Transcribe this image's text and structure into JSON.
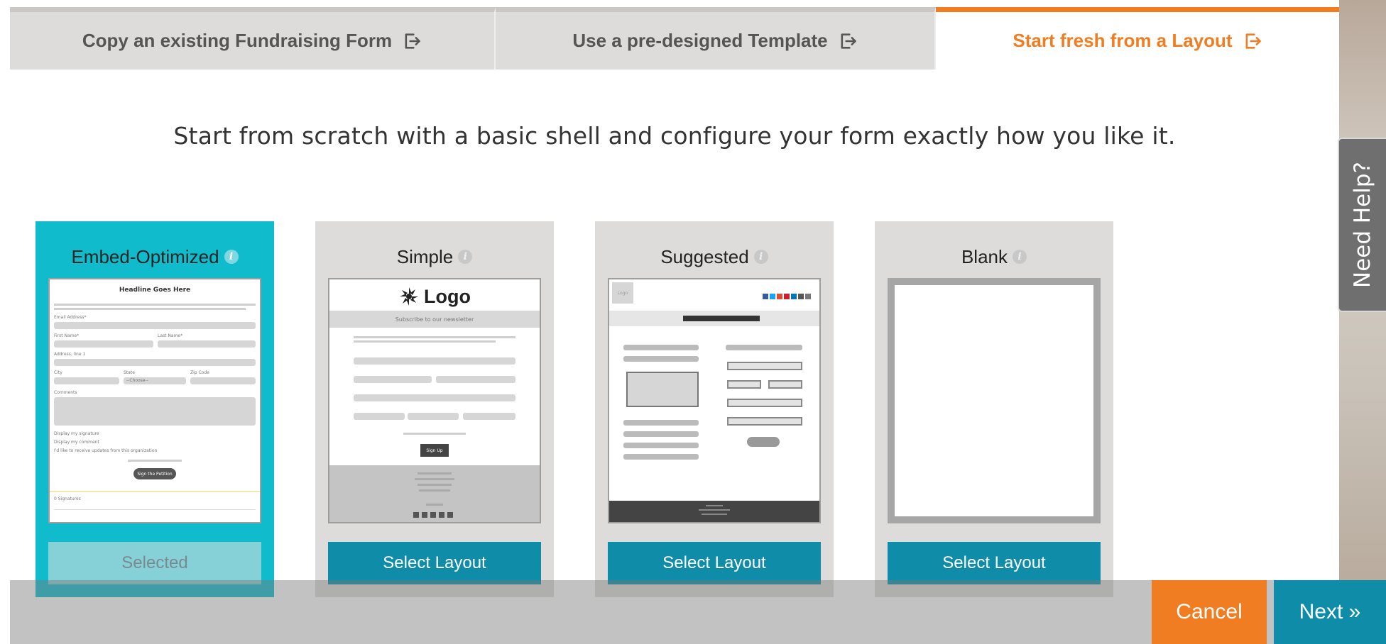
{
  "tabs": [
    {
      "label": "Copy an existing Fundraising Form",
      "active": false
    },
    {
      "label": "Use a pre-designed Template",
      "active": false
    },
    {
      "label": "Start fresh from a Layout",
      "active": true
    }
  ],
  "intro": "Start from scratch with a basic shell and configure your form exactly how you like it.",
  "cards": [
    {
      "title": "Embed-Optimized",
      "button": "Selected",
      "selected": true
    },
    {
      "title": "Simple",
      "button": "Select Layout",
      "selected": false
    },
    {
      "title": "Suggested",
      "button": "Select Layout",
      "selected": false
    },
    {
      "title": "Blank",
      "button": "Select Layout",
      "selected": false
    }
  ],
  "thumbs": {
    "embed": {
      "headline": "Headline Goes Here",
      "email": "Email Address*",
      "first": "First Name*",
      "last": "Last Name*",
      "address": "Address, line 1",
      "city": "City",
      "state": "State",
      "zip": "Zip Code",
      "state_value": "--Choose--",
      "comments": "Comments",
      "check1": "Display my signature",
      "check2": "Display my comment",
      "check3": "I'd like to receive updates from this organization",
      "submit": "Sign the Petition",
      "signatures": "0 Signatures"
    },
    "simple": {
      "logo": "Logo",
      "subtitle": "Subscribe to our newsletter",
      "submit": "Sign Up"
    },
    "suggested": {
      "logo": "Logo"
    }
  },
  "footer": {
    "cancel": "Cancel",
    "next": "Next »"
  },
  "need_help": "Need Help?",
  "colors": {
    "accent": "#f07d22",
    "primary": "#0e8ca8",
    "selected": "#10bccc",
    "inactive_tab": "#dddcdb"
  },
  "icons": {
    "external": "external-link-icon",
    "info": "info-icon"
  }
}
